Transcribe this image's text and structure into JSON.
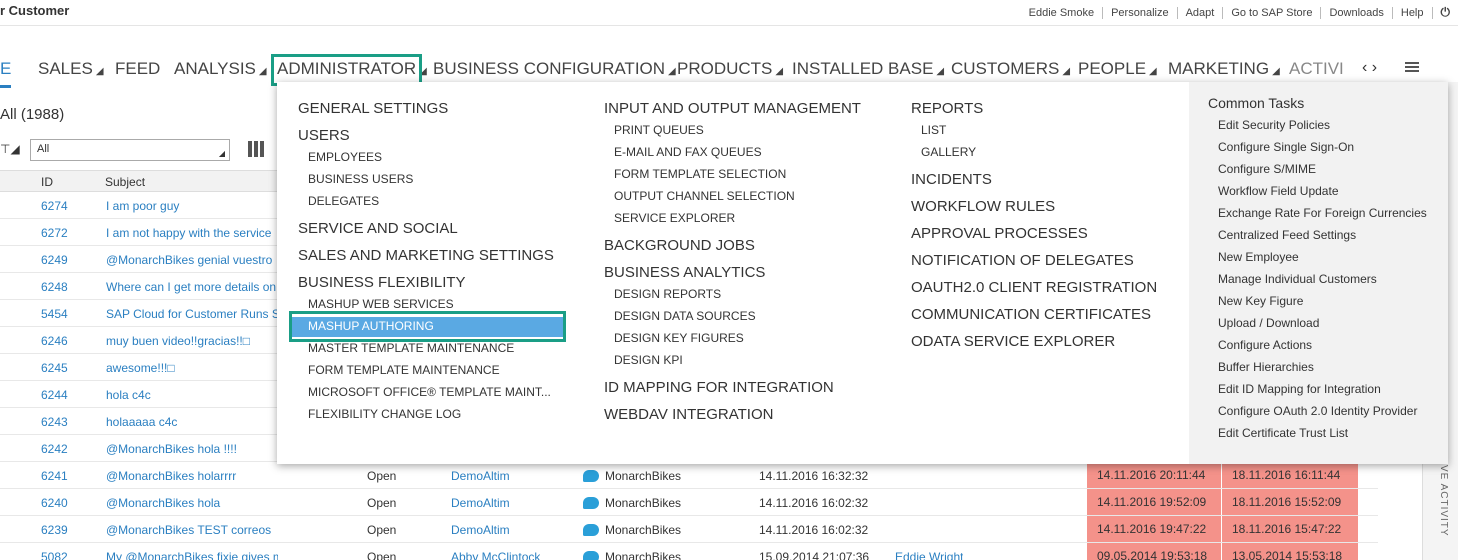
{
  "app": {
    "title": "r Customer"
  },
  "toplinks": [
    "Eddie Smoke",
    "Personalize",
    "Adapt",
    "Go to SAP Store",
    "Downloads",
    "Help"
  ],
  "nav": {
    "items": [
      {
        "label": "E"
      },
      {
        "label": "SALES"
      },
      {
        "label": "FEED"
      },
      {
        "label": "ANALYSIS"
      },
      {
        "label": "ADMINISTRATOR"
      },
      {
        "label": "BUSINESS CONFIGURATION"
      },
      {
        "label": "PRODUCTS"
      },
      {
        "label": "INSTALLED BASE"
      },
      {
        "label": "CUSTOMERS"
      },
      {
        "label": "PEOPLE"
      },
      {
        "label": "MARKETING"
      },
      {
        "label": "ACTIVI"
      }
    ],
    "arrows": "< >"
  },
  "list": {
    "title": "All (1988)",
    "filter_value": "All",
    "headers": {
      "id": "ID",
      "subject": "Subject"
    },
    "rows": [
      {
        "id": "6274",
        "subject": "I am poor guy"
      },
      {
        "id": "6272",
        "subject": "I am not happy with the service"
      },
      {
        "id": "6249",
        "subject": "@MonarchBikes  genial vuestro"
      },
      {
        "id": "6248",
        "subject": "Where can I get more details on"
      },
      {
        "id": "5454",
        "subject": "SAP Cloud for Customer Runs S"
      },
      {
        "id": "6246",
        "subject": "muy buen video!!gracias!!□"
      },
      {
        "id": "6245",
        "subject": "awesome!!!□"
      },
      {
        "id": "6244",
        "subject": "hola c4c"
      },
      {
        "id": "6243",
        "subject": "holaaaaa c4c"
      },
      {
        "id": "6242",
        "subject": "@MonarchBikes hola !!!!"
      },
      {
        "id": "6241",
        "subject": "@MonarchBikes holarrrr",
        "status": "Open",
        "owner": "DemoAltim",
        "channel": "MonarchBikes",
        "created": "14.11.2016 16:32:32",
        "agent": "",
        "due1": "14.11.2016 20:11:44",
        "due2": "18.11.2016 16:11:44"
      },
      {
        "id": "6240",
        "subject": "@MonarchBikes hola",
        "status": "Open",
        "owner": "DemoAltim",
        "channel": "MonarchBikes",
        "created": "14.11.2016 16:02:32",
        "agent": "",
        "due1": "14.11.2016 19:52:09",
        "due2": "18.11.2016 15:52:09"
      },
      {
        "id": "6239",
        "subject": "@MonarchBikes TEST correos",
        "status": "Open",
        "owner": "DemoAltim",
        "channel": "MonarchBikes",
        "created": "14.11.2016 16:02:32",
        "agent": "",
        "due1": "14.11.2016 19:47:22",
        "due2": "18.11.2016 15:47:22"
      },
      {
        "id": "5082",
        "subject": "My @MonarchBikes fixie gives me a feelin",
        "status": "Open",
        "owner": "Abby McClintock",
        "channel": "MonarchBikes",
        "created": "15.09.2014 21:07:36",
        "agent": "Eddie Wright",
        "due1": "09.05.2014 19:53:18",
        "due2": "13.05.2014 15:53:18"
      }
    ]
  },
  "side_panel": {
    "label": "VE ACTIVITY"
  },
  "menu": {
    "col1": {
      "general_settings": "GENERAL SETTINGS",
      "users": "USERS",
      "users_items": [
        "EMPLOYEES",
        "BUSINESS USERS",
        "DELEGATES"
      ],
      "service_social": "SERVICE AND SOCIAL",
      "sales_marketing": "SALES AND MARKETING SETTINGS",
      "business_flex": "BUSINESS FLEXIBILITY",
      "flex_items": [
        "MASHUP WEB SERVICES",
        "MASHUP AUTHORING",
        "MASTER TEMPLATE MAINTENANCE",
        "FORM TEMPLATE MAINTENANCE",
        "MICROSOFT OFFICE® TEMPLATE MAINT...",
        "FLEXIBILITY CHANGE LOG"
      ]
    },
    "col2": {
      "io_mgmt": "INPUT AND OUTPUT MANAGEMENT",
      "io_items": [
        "PRINT QUEUES",
        "E-MAIL AND FAX QUEUES",
        "FORM TEMPLATE SELECTION",
        "OUTPUT CHANNEL SELECTION",
        "SERVICE EXPLORER"
      ],
      "background_jobs": "BACKGROUND JOBS",
      "business_analytics": "BUSINESS ANALYTICS",
      "analytics_items": [
        "DESIGN REPORTS",
        "DESIGN DATA SOURCES",
        "DESIGN KEY FIGURES",
        "DESIGN KPI"
      ],
      "id_mapping": "ID MAPPING FOR INTEGRATION",
      "webdav": "WEBDAV INTEGRATION"
    },
    "col3": {
      "reports": "REPORTS",
      "reports_items": [
        "LIST",
        "GALLERY"
      ],
      "others": [
        "INCIDENTS",
        "WORKFLOW RULES",
        "APPROVAL PROCESSES",
        "NOTIFICATION OF DELEGATES",
        "OAUTH2.0 CLIENT REGISTRATION",
        "COMMUNICATION CERTIFICATES",
        "ODATA SERVICE EXPLORER"
      ]
    },
    "common_tasks": {
      "title": "Common Tasks",
      "items": [
        "Edit Security Policies",
        "Configure Single Sign-On",
        "Configure S/MIME",
        "Workflow Field Update",
        "Exchange Rate For Foreign Currencies",
        "Centralized Feed Settings",
        "New Employee",
        "Manage Individual Customers",
        "New Key Figure",
        "Upload / Download",
        "Configure Actions",
        "Buffer Hierarchies",
        "Edit ID Mapping for Integration",
        "Configure OAuth 2.0 Identity Provider",
        "Edit Certificate Trust List"
      ]
    }
  }
}
